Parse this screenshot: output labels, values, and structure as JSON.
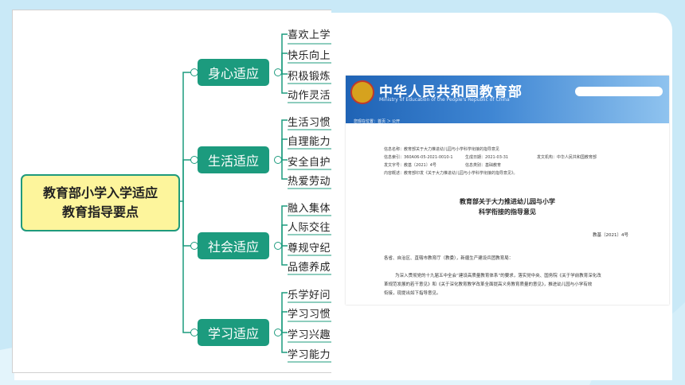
{
  "mindmap": {
    "root": [
      "教育部小学入学适应",
      "教育指导要点"
    ],
    "categories": [
      {
        "label": "身心适应",
        "items": [
          "喜欢上学",
          "快乐向上",
          "积极锻炼",
          "动作灵活"
        ]
      },
      {
        "label": "生活适应",
        "items": [
          "生活习惯",
          "自理能力",
          "安全自护",
          "热爱劳动"
        ]
      },
      {
        "label": "社会适应",
        "items": [
          "融入集体",
          "人际交往",
          "尊规守纪",
          "品德养成"
        ]
      },
      {
        "label": "学习适应",
        "items": [
          "乐学好问",
          "学习习惯",
          "学习兴趣",
          "学习能力"
        ]
      }
    ]
  },
  "document": {
    "header_title": "中华人民共和国教育部",
    "header_subtitle": "Ministry of Education of the People's Republic of China",
    "breadcrumb": "您现在位置：首页 ＞ 公开",
    "meta": {
      "index_label": "信息名称：",
      "index_value": "教育部关于大力推进幼儿园与小学科学衔接的指导意见",
      "code_label": "信息索引：",
      "code_value": "360A06-05-2021-0010-1",
      "date_label": "生成日期：",
      "date_value": "2021-03-31",
      "issuer_label": "发文机构：",
      "issuer_value": "中华人民共和国教育部",
      "docno_label": "发文字号：",
      "docno_value": "教基〔2021〕4号",
      "category_label": "信息类别：",
      "category_value": "基础教育",
      "summary_label": "内容概述：",
      "summary_value": "教育部印发《关于大力推进幼儿园与小学科学衔接的指导意见》。"
    },
    "title_line1": "教育部关于大力推进幼儿园与小学",
    "title_line2": "科学衔接的指导意见",
    "doc_number": "教基〔2021〕4号",
    "salutation": "各省、自治区、直辖市教育厅（教委），新疆生产建设兵团教育局：",
    "body1": "为深入贯彻党的十九届五中全会“建设高质量教育体系”的要求，落实党中央、国务院《关于学前教育深化改",
    "body2": "革规范发展的若干意见》和《关于深化教育教学改革全面提高义务教育质量的意见》，推进幼儿园与小学有效",
    "body3": "衔接，现提出如下指导意见。"
  }
}
